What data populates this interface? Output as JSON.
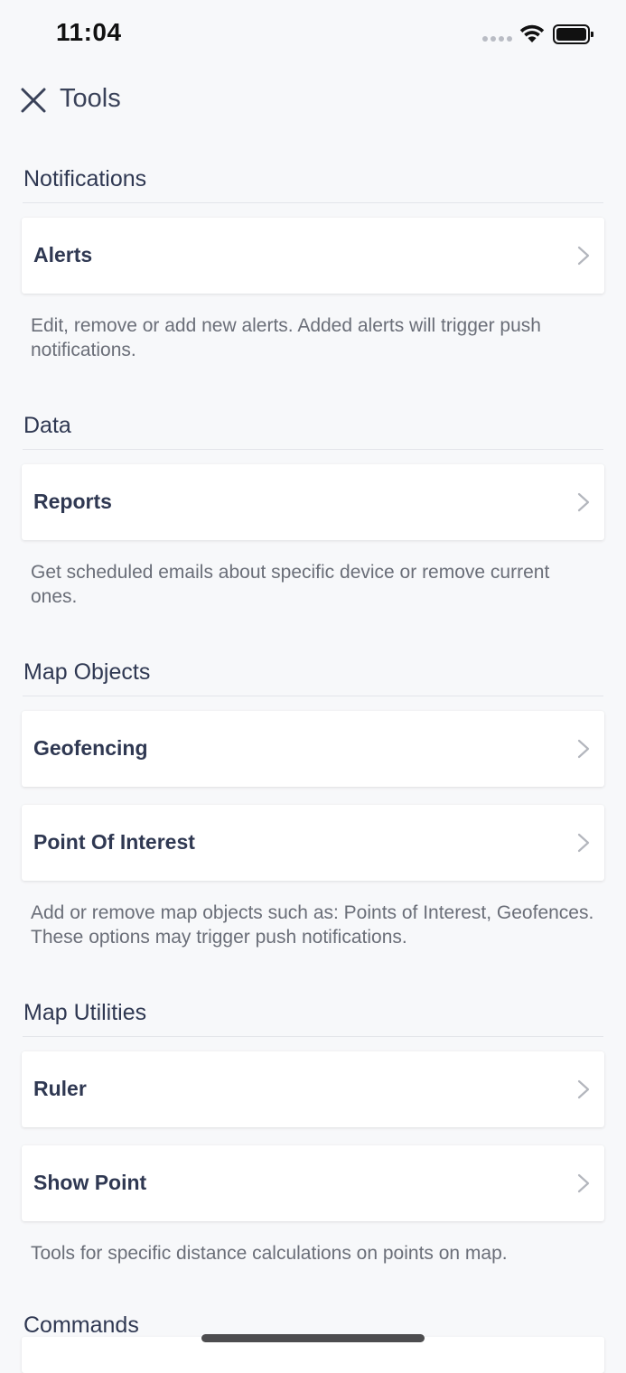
{
  "status_bar": {
    "time": "11:04"
  },
  "nav": {
    "title": "Tools",
    "close_icon": "close-icon"
  },
  "sections": [
    {
      "header": "Notifications",
      "items": [
        {
          "label": "Alerts"
        }
      ],
      "description": "Edit, remove or add new alerts. Added alerts will trigger push notifications."
    },
    {
      "header": "Data",
      "items": [
        {
          "label": "Reports"
        }
      ],
      "description": "Get scheduled emails about specific device or remove current ones."
    },
    {
      "header": "Map Objects",
      "items": [
        {
          "label": "Geofencing"
        },
        {
          "label": "Point Of Interest"
        }
      ],
      "description": "Add or remove map objects such as: Points of Interest, Geofences. These options may trigger push notifications."
    },
    {
      "header": "Map Utilities",
      "items": [
        {
          "label": "Ruler"
        },
        {
          "label": "Show Point"
        }
      ],
      "description": "Tools for specific distance calculations on points on map."
    },
    {
      "header": "Commands"
    }
  ],
  "colors": {
    "background": "#f7f8fa",
    "text_primary": "#2f3852",
    "text_secondary": "#6a6e78",
    "cell_background": "#ffffff",
    "chevron": "#b3b6bd"
  }
}
